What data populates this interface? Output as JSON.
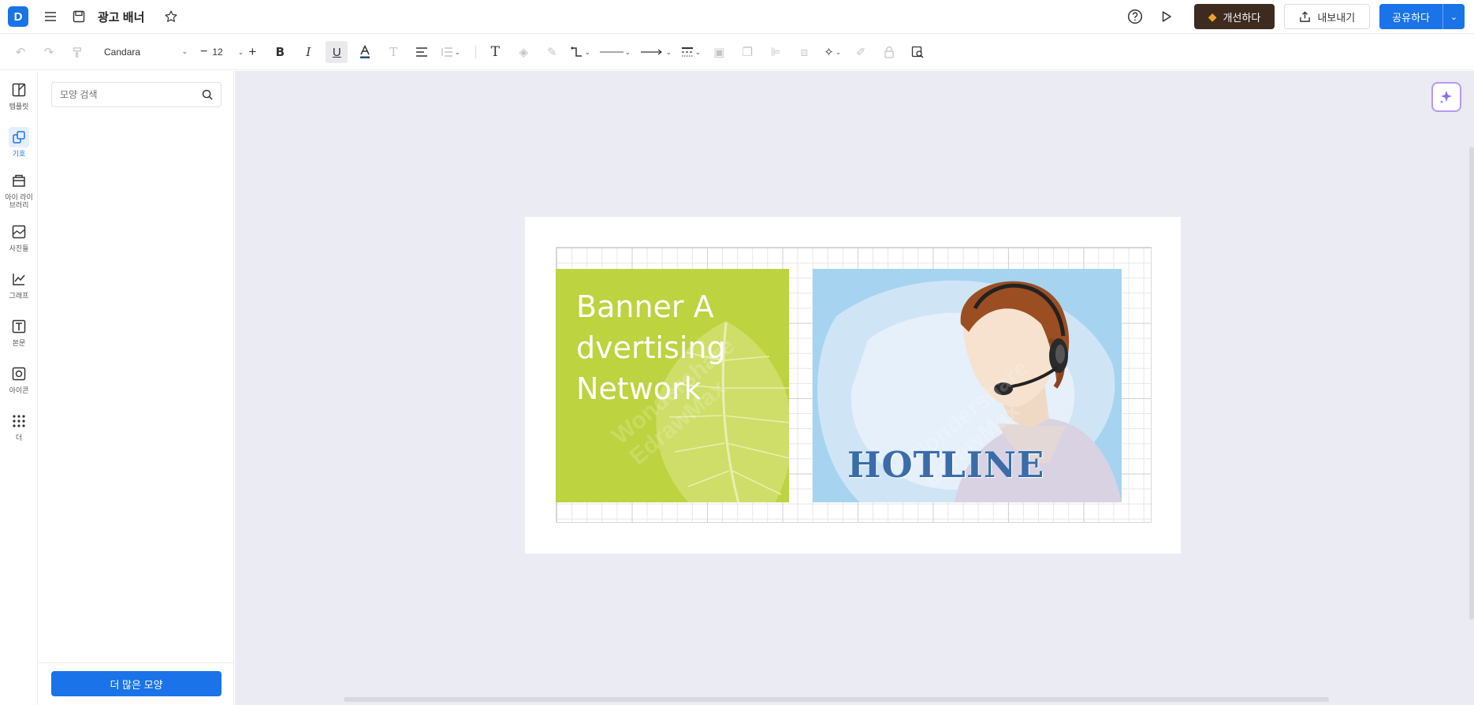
{
  "header": {
    "logo_text": "D",
    "doc_title": "광고 배너",
    "upgrade_label": "개선하다",
    "export_label": "내보내기",
    "share_label": "공유하다"
  },
  "toolbar": {
    "font_family": "Candara",
    "font_size": "12"
  },
  "rail": {
    "items": [
      {
        "label": "템플릿",
        "icon": "template-icon"
      },
      {
        "label": "기호",
        "icon": "symbol-icon"
      },
      {
        "label": "아이 라이브러리",
        "icon": "library-icon"
      },
      {
        "label": "사진들",
        "icon": "image-icon"
      },
      {
        "label": "그래프",
        "icon": "chart-icon"
      },
      {
        "label": "본문",
        "icon": "text-icon"
      },
      {
        "label": "아이콘",
        "icon": "icon-icon"
      },
      {
        "label": "더",
        "icon": "more-icon"
      }
    ]
  },
  "panel": {
    "search_placeholder": "모양 검색",
    "more_shapes_label": "더 많은 모양"
  },
  "canvas": {
    "banner_text": "Banner Advertising Network",
    "hotline_text": "HOTLINE",
    "watermark_text": "Wondershare EdrawMax"
  },
  "colors": {
    "accent": "#1a73e8",
    "upgrade_bg": "#3d2b1f",
    "green_card": "#bdd33f",
    "blue_card": "#a6d4f0",
    "canvas_bg": "#ebebf3"
  }
}
